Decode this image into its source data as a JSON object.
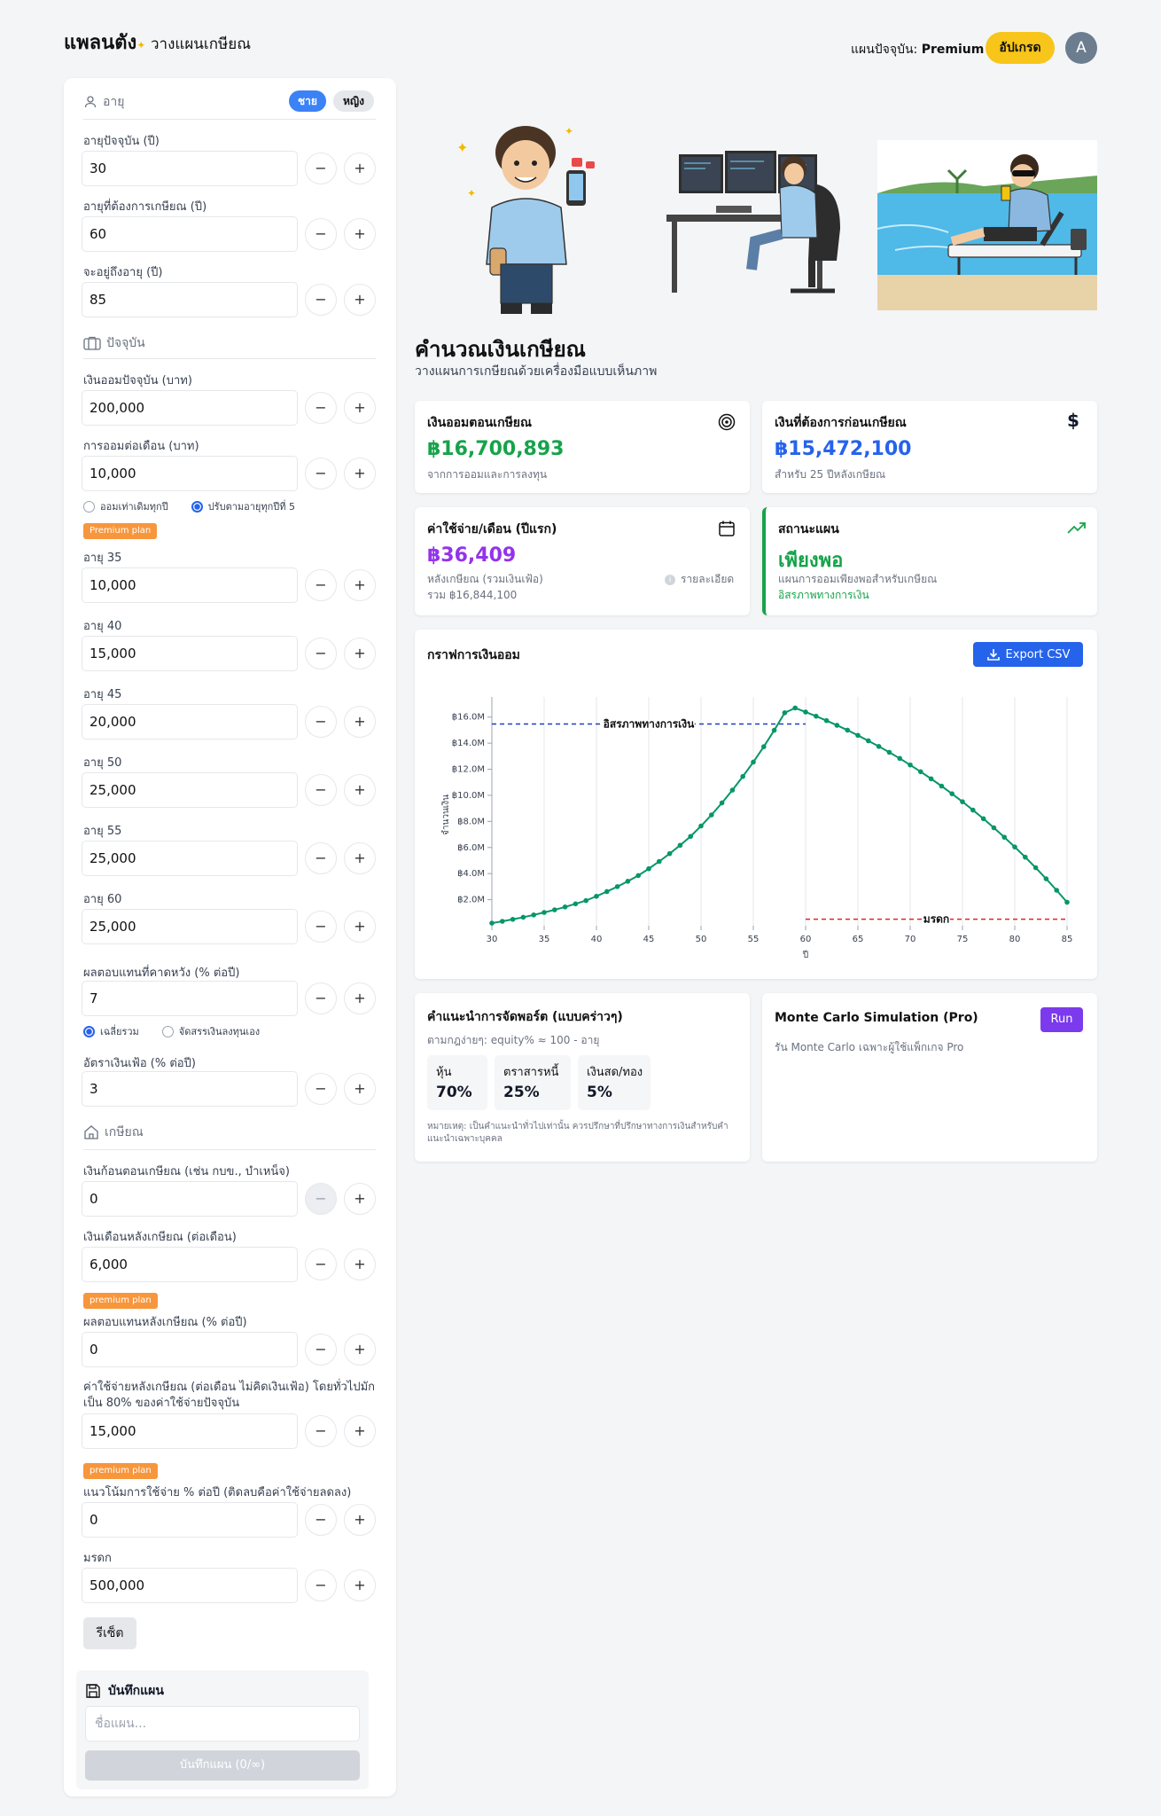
{
  "header": {
    "logo": "แพลนตัง",
    "subtitle": "วางแผนเกษียณ",
    "plan_prefix": "แผนปัจจุบัน:",
    "plan_name": "Premium",
    "upgrade": "อัปเกรด",
    "avatar": "A"
  },
  "sidebar": {
    "age": {
      "title": "อายุ",
      "male": "ชาย",
      "female": "หญิง",
      "current_label": "อายุปัจจุบัน (ปี)",
      "current": "30",
      "retire_label": "อายุที่ต้องการเกษียณ (ปี)",
      "retire": "60",
      "live_label": "จะอยู่ถึงอายุ (ปี)",
      "live": "85"
    },
    "now": {
      "title": "ปัจจุบัน",
      "savings_label": "เงินออมปัจจุบัน (บาท)",
      "savings": "200,000",
      "monthly_label": "การออมต่อเดือน (บาท)",
      "monthly": "10,000",
      "opt_same": "ออมเท่าเดิมทุกปี",
      "opt_adjust": "ปรับตามอายุทุกปีที่ 5",
      "badge": "Premium plan",
      "steps": [
        {
          "label": "อายุ 35",
          "value": "10,000"
        },
        {
          "label": "อายุ 40",
          "value": "15,000"
        },
        {
          "label": "อายุ 45",
          "value": "20,000"
        },
        {
          "label": "อายุ 50",
          "value": "25,000"
        },
        {
          "label": "อายุ 55",
          "value": "25,000"
        },
        {
          "label": "อายุ 60",
          "value": "25,000"
        }
      ],
      "return_label": "ผลตอบแทนที่คาดหวัง (% ต่อปี)",
      "return": "7",
      "opt_avg": "เฉลี่ยรวม",
      "opt_self": "จัดสรรเงินลงทุนเอง",
      "inflation_label": "อัตราเงินเฟ้อ (% ต่อปี)",
      "inflation": "3"
    },
    "retire": {
      "title": "เกษียณ",
      "lump_label": "เงินก้อนตอนเกษียณ (เช่น กบข., บำเหน็จ)",
      "lump": "0",
      "pension_label": "เงินเดือนหลังเกษียณ (ต่อเดือน)",
      "pension": "6,000",
      "badge": "premium plan",
      "post_return_label": "ผลตอบแทนหลังเกษียณ (% ต่อปี)",
      "post_return": "0",
      "expense_label": "ค่าใช้จ่ายหลังเกษียณ (ต่อเดือน ไม่คิดเงินเฟ้อ) โดยทั่วไปมักเป็น 80% ของค่าใช้จ่ายปัจจุบัน",
      "expense": "15,000",
      "trend_label": "แนวโน้มการใช้จ่าย % ต่อปี (ติดลบคือค่าใช้จ่ายลดลง)",
      "trend": "0",
      "legacy_label": "มรดก",
      "legacy": "500,000"
    },
    "reset": "รีเซ็ต",
    "save": {
      "title": "บันทึกแผน",
      "placeholder": "ชื่อแผน...",
      "button": "บันทึกแผน (0/∞)"
    }
  },
  "main": {
    "title": "คำนวณเงินเกษียณ",
    "desc": "วางแผนการเกษียณด้วยเครื่องมือแบบเห็นภาพ",
    "cards": {
      "saved": {
        "title": "เงินออมตอนเกษียณ",
        "value": "฿16,700,893",
        "sub": "จากการออมและการลงทุน"
      },
      "needed": {
        "title": "เงินที่ต้องการก่อนเกษียณ",
        "value": "฿15,472,100",
        "sub": "สำหรับ 25 ปีหลังเกษียณ"
      },
      "expense": {
        "title": "ค่าใช้จ่าย/เดือน (ปีแรก)",
        "value": "฿36,409",
        "sub": "หลังเกษียณ (รวมเงินเฟ้อ)",
        "sub2": "รวม ฿16,844,100",
        "detail": "รายละเอียด"
      },
      "status": {
        "title": "สถานะแผน",
        "value": "เพียงพอ",
        "sub": "แผนการออมเพียงพอสำหรับเกษียณ",
        "sub2": "อิสรภาพทางการเงิน"
      }
    },
    "chart_title": "กราฟการเงินออม",
    "export": "Export CSV",
    "portfolio": {
      "title": "คำแนะนำการจัดพอร์ต (แบบคร่าวๆ)",
      "rule": "ตามกฎง่ายๆ: equity% ≈ 100 - อายุ",
      "items": [
        {
          "label": "หุ้น",
          "value": "70%"
        },
        {
          "label": "ตราสารหนี้",
          "value": "25%"
        },
        {
          "label": "เงินสด/ทอง",
          "value": "5%"
        }
      ],
      "note": "หมายเหตุ: เป็นคำแนะนำทั่วไปเท่านั้น ควรปรึกษาที่ปรึกษาทางการเงินสำหรับคำแนะนำเฉพาะบุคคล"
    },
    "montecarlo": {
      "title": "Monte Carlo Simulation (Pro)",
      "run": "Run",
      "desc": "รัน Monte Carlo เฉพาะผู้ใช้แพ็กเกจ Pro"
    }
  },
  "chart_data": {
    "type": "line",
    "ylabel": "จำนวนเงิน",
    "xlabel": "ปี",
    "x": [
      30,
      31,
      32,
      33,
      34,
      35,
      36,
      37,
      38,
      39,
      40,
      41,
      42,
      43,
      44,
      45,
      46,
      47,
      48,
      49,
      50,
      51,
      52,
      53,
      54,
      55,
      56,
      57,
      58,
      59,
      60,
      61,
      62,
      63,
      64,
      65,
      66,
      67,
      68,
      69,
      70,
      71,
      72,
      73,
      74,
      75,
      76,
      77,
      78,
      79,
      80,
      81,
      82,
      83,
      84,
      85
    ],
    "values": [
      0.2,
      0.34,
      0.49,
      0.65,
      0.83,
      1.02,
      1.22,
      1.44,
      1.68,
      1.93,
      2.26,
      2.62,
      3.0,
      3.41,
      3.85,
      4.37,
      4.93,
      5.53,
      6.17,
      6.85,
      7.65,
      8.5,
      9.42,
      10.4,
      11.45,
      12.55,
      13.73,
      14.99,
      16.33,
      16.7,
      16.39,
      16.07,
      15.73,
      15.37,
      15.0,
      14.6,
      14.18,
      13.75,
      13.3,
      12.83,
      12.33,
      11.81,
      11.27,
      10.71,
      10.12,
      9.51,
      8.87,
      8.21,
      7.51,
      6.79,
      6.04,
      5.26,
      4.45,
      3.6,
      2.72,
      1.8
    ],
    "xticks": [
      "30",
      "35",
      "40",
      "45",
      "50",
      "55",
      "60",
      "65",
      "70",
      "75",
      "80",
      "85"
    ],
    "yticks": [
      "฿2.0M",
      "฿4.0M",
      "฿6.0M",
      "฿8.0M",
      "฿10.0M",
      "฿12.0M",
      "฿14.0M",
      "฿16.0M"
    ],
    "ylim": [
      0,
      17
    ],
    "annotations": [
      {
        "text": "อิสรภาพทางการเงิน",
        "y": 15.47
      },
      {
        "text": "มรดก",
        "y": 0.5
      }
    ],
    "colors": {
      "line": "#059669",
      "target": "#1e3fbf",
      "legacy": "#dc2626"
    }
  }
}
